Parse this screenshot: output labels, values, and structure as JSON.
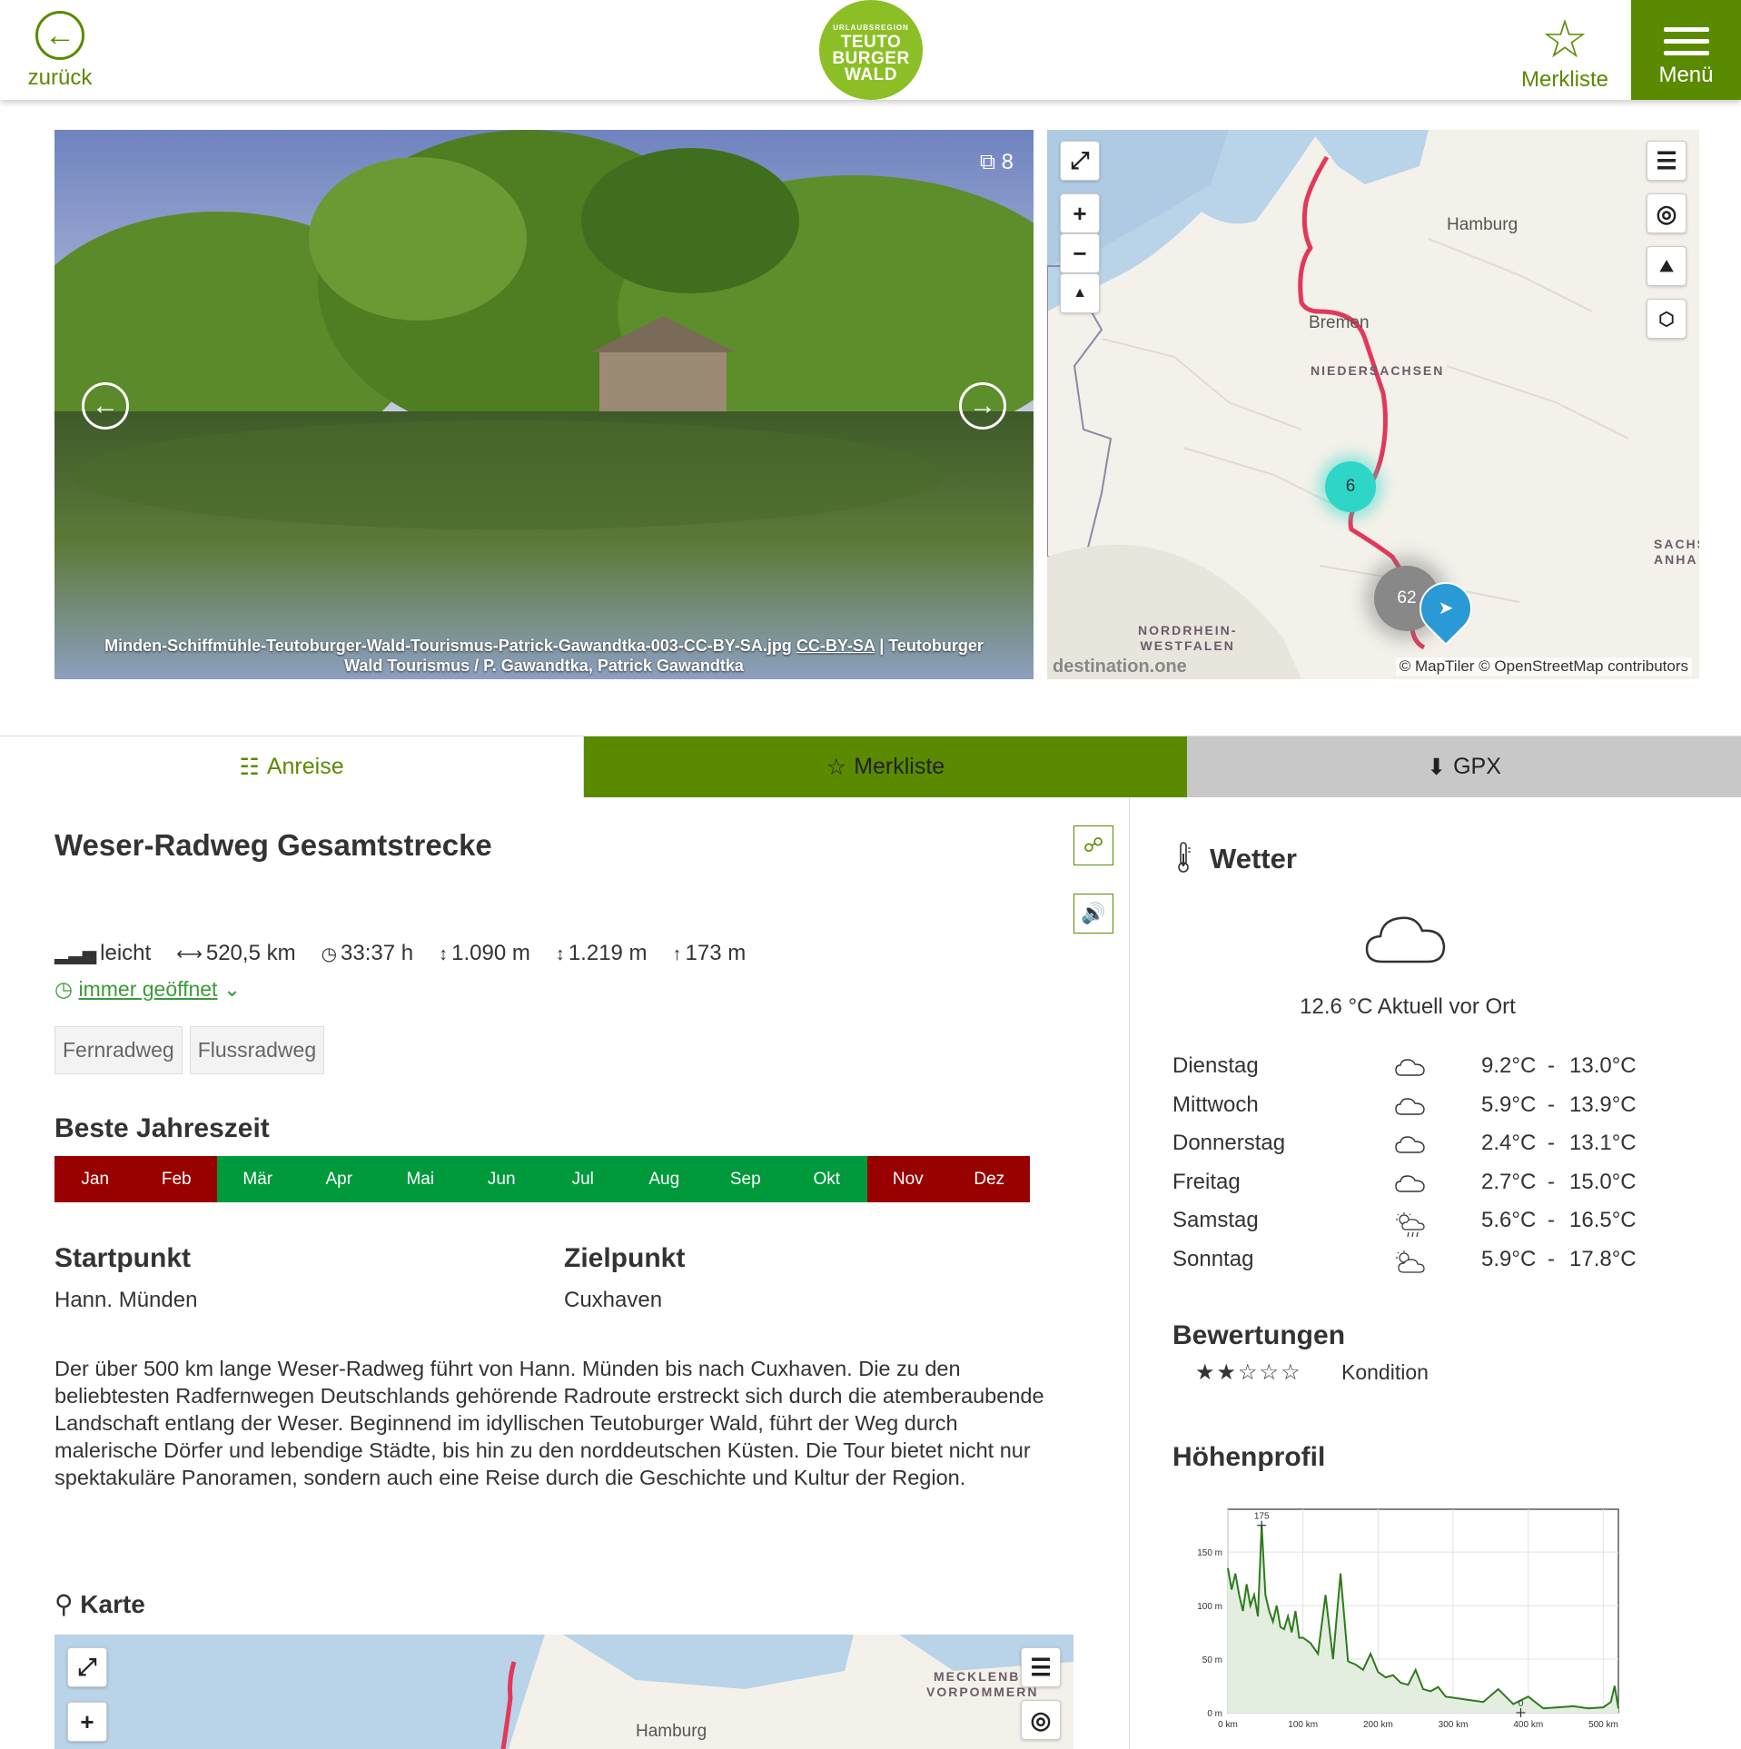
{
  "header": {
    "back_label": "zurück",
    "logo_small": "URLAUBSREGION",
    "logo_line1": "TEUTO",
    "logo_line2": "BURGER",
    "logo_line3": "WALD",
    "merkliste_label": "Merkliste",
    "menu_label": "Menü"
  },
  "gallery": {
    "count": "8",
    "caption_file": "Minden-Schiffmühle-Teutoburger-Wald-Tourismus-Patrick-Gawandtka-003-CC-BY-SA.jpg",
    "caption_license": "CC-BY-SA",
    "caption_credit": "| Teutoburger Wald Tourismus / P. Gawandtka, Patrick Gawandtka"
  },
  "map_top": {
    "labels": {
      "hamburg": "Hamburg",
      "bremen": "Bremen",
      "niedersachsen": "NIEDERSACHSEN",
      "nrw1": "NORDRHEIN-",
      "nrw2": "WESTFALEN",
      "sachsen1": "SACHS",
      "sachsen2": "ANHA"
    },
    "cluster_small": "6",
    "cluster_large": "62",
    "watermark": "destination.one",
    "attribution": "© MapTiler © OpenStreetMap contributors"
  },
  "tabs": {
    "anreise": "Anreise",
    "merkliste": "Merkliste",
    "gpx": "GPX"
  },
  "tour": {
    "title": "Weser-Radweg Gesamtstrecke",
    "difficulty": "leicht",
    "distance": "520,5 km",
    "duration": "33:37 h",
    "ascent": "1.090 m",
    "descent": "1.219 m",
    "max_altitude": "173 m",
    "opening": "immer geöffnet",
    "tags": [
      "Fernradweg",
      "Flussradweg"
    ]
  },
  "season": {
    "heading": "Beste Jahreszeit",
    "months": [
      "Jan",
      "Feb",
      "Mär",
      "Apr",
      "Mai",
      "Jun",
      "Jul",
      "Aug",
      "Sep",
      "Okt",
      "Nov",
      "Dez"
    ],
    "recommended": [
      false,
      false,
      true,
      true,
      true,
      true,
      true,
      true,
      true,
      true,
      false,
      false
    ],
    "color_good": "#009a3c",
    "color_bad": "#990000"
  },
  "route": {
    "start_heading": "Startpunkt",
    "start_value": "Hann. Münden",
    "end_heading": "Zielpunkt",
    "end_value": "Cuxhaven"
  },
  "description": "Der über 500 km lange Weser-Radweg führt von Hann. Münden bis nach Cuxhaven. Die zu den beliebtesten Radfernwegen Deutschlands gehörende Radroute erstreckt sich durch die atemberaubende Landschaft entlang der Weser. Beginnend im idyllischen Teutoburger Wald, führt der Weg durch malerische Dörfer und lebendige Städte, bis hin zu den norddeutschen Küsten. Die Tour bietet nicht nur spektakuläre Panoramen, sondern auch eine Reise durch die Geschichte und Kultur der Region.",
  "map_section": {
    "heading": "Karte",
    "labels": {
      "hamburg": "Hamburg",
      "meck1": "MECKLENBU",
      "meck2": "VORPOMMERN"
    }
  },
  "weather": {
    "heading": "Wetter",
    "current": "12.6 °C Aktuell vor Ort",
    "days": [
      {
        "day": "Dienstag",
        "icon": "cloud-icon",
        "min": "9.2°C",
        "sep": "-",
        "max": "13.0°C"
      },
      {
        "day": "Mittwoch",
        "icon": "cloud-icon",
        "min": "5.9°C",
        "sep": "-",
        "max": "13.9°C"
      },
      {
        "day": "Donnerstag",
        "icon": "cloud-icon",
        "min": "2.4°C",
        "sep": "-",
        "max": "13.1°C"
      },
      {
        "day": "Freitag",
        "icon": "cloud-icon",
        "min": "2.7°C",
        "sep": "-",
        "max": "15.0°C"
      },
      {
        "day": "Samstag",
        "icon": "sun-rain-icon",
        "min": "5.6°C",
        "sep": "-",
        "max": "16.5°C"
      },
      {
        "day": "Sonntag",
        "icon": "sun-cloud-icon",
        "min": "5.9°C",
        "sep": "-",
        "max": "17.8°C"
      }
    ]
  },
  "ratings": {
    "heading": "Bewertungen",
    "label": "Kondition",
    "value": 2,
    "max": 5
  },
  "profile": {
    "heading": "Höhenprofil"
  },
  "chart_data": {
    "type": "area",
    "title": "",
    "xlabel": "",
    "ylabel": "",
    "x_ticks": [
      "0 km",
      "100 km",
      "200 km",
      "300 km",
      "400 km",
      "500 km"
    ],
    "y_ticks": [
      "0 m",
      "50 m",
      "100 m",
      "150 m"
    ],
    "xlim": [
      0,
      520
    ],
    "ylim": [
      0,
      190
    ],
    "annotations": [
      {
        "label": "175",
        "x": 45,
        "y": 175
      },
      {
        "label": "0",
        "x": 390,
        "y": 0
      }
    ],
    "x": [
      0,
      5,
      10,
      15,
      20,
      25,
      30,
      35,
      40,
      45,
      50,
      55,
      60,
      65,
      70,
      75,
      80,
      85,
      90,
      95,
      100,
      110,
      120,
      130,
      140,
      150,
      160,
      170,
      180,
      190,
      200,
      210,
      220,
      230,
      240,
      250,
      260,
      270,
      280,
      290,
      300,
      320,
      340,
      360,
      380,
      400,
      420,
      440,
      460,
      480,
      500,
      510,
      515,
      520
    ],
    "y": [
      135,
      115,
      130,
      110,
      95,
      120,
      100,
      110,
      90,
      175,
      110,
      95,
      85,
      100,
      80,
      78,
      90,
      75,
      95,
      70,
      70,
      65,
      55,
      110,
      50,
      130,
      48,
      45,
      40,
      55,
      38,
      33,
      35,
      28,
      26,
      40,
      22,
      20,
      24,
      15,
      14,
      12,
      10,
      22,
      8,
      15,
      4,
      5,
      6,
      4,
      5,
      10,
      25,
      4
    ]
  }
}
